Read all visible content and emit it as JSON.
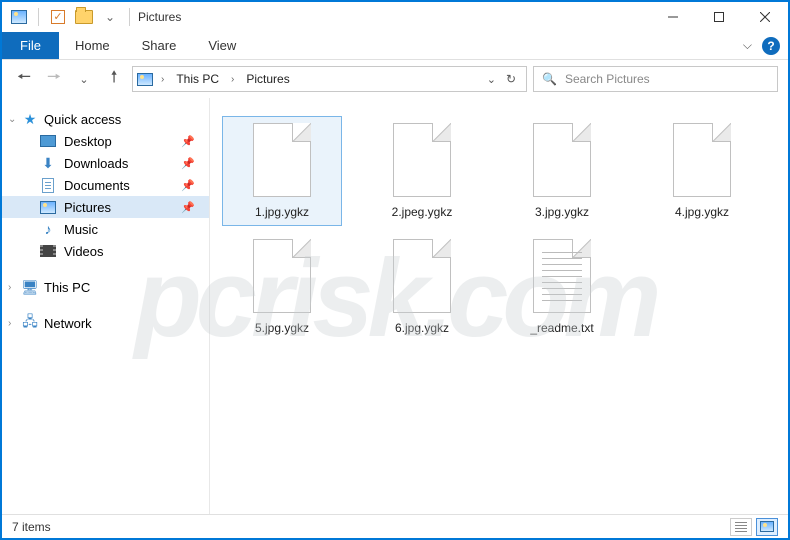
{
  "window": {
    "title": "Pictures"
  },
  "ribbon": {
    "file": "File",
    "tabs": [
      "Home",
      "Share",
      "View"
    ],
    "help": "?"
  },
  "breadcrumb": {
    "segments": [
      "This PC",
      "Pictures"
    ]
  },
  "search": {
    "placeholder": "Search Pictures"
  },
  "nav": {
    "quick_access": {
      "label": "Quick access"
    },
    "items": [
      {
        "label": "Desktop",
        "pinned": true
      },
      {
        "label": "Downloads",
        "pinned": true
      },
      {
        "label": "Documents",
        "pinned": true
      },
      {
        "label": "Pictures",
        "pinned": true,
        "selected": true
      },
      {
        "label": "Music",
        "pinned": false
      },
      {
        "label": "Videos",
        "pinned": false
      }
    ],
    "this_pc": {
      "label": "This PC"
    },
    "network": {
      "label": "Network"
    }
  },
  "files": [
    {
      "name": "1.jpg.ygkz",
      "type": "file",
      "selected": true
    },
    {
      "name": "2.jpeg.ygkz",
      "type": "file"
    },
    {
      "name": "3.jpg.ygkz",
      "type": "file"
    },
    {
      "name": "4.jpg.ygkz",
      "type": "file"
    },
    {
      "name": "5.jpg.ygkz",
      "type": "file"
    },
    {
      "name": "6.jpg.ygkz",
      "type": "file"
    },
    {
      "name": "_readme.txt",
      "type": "txt"
    }
  ],
  "status": {
    "count_text": "7 items"
  },
  "watermark": "pcrisk.com"
}
